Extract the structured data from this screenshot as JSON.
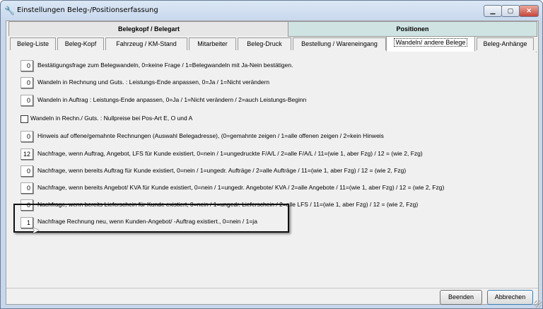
{
  "window": {
    "title": "Einstellungen Beleg-/Positionserfassung"
  },
  "top_tabs": [
    "Belegkopf / Belegart",
    "Positionen"
  ],
  "sub_tabs": [
    "Beleg-Liste",
    "Beleg-Kopf",
    "Fahrzeug / KM-Stand",
    "Mitarbeiter",
    "Beleg-Druck",
    "Bestellung / Wareneingang",
    "Wandeln/ andere Belege",
    "Beleg-Anhänge"
  ],
  "active_sub_tab": "Wandeln/ andere Belege",
  "settings": [
    {
      "value": "0",
      "label": "Bestätigungsfrage zum Belegwandeln, 0=keine Frage / 1=Belegwandeln mit Ja-Nein bestätigen."
    },
    {
      "value": "0",
      "label": "Wandeln in Rechnung und Guts. : Leistungs-Ende anpassen, 0=Ja / 1=Nicht verändern"
    },
    {
      "value": "0",
      "label": "Wandeln in Auftrag : Leistungs-Ende anpassen, 0=Ja / 1=Nicht verändern / 2=auch Leistungs-Beginn"
    },
    {
      "checkbox": true,
      "checked": false,
      "label": "Wandeln in Rechn./ Guts. : Nullpreise bei Pos-Art E, O und A"
    },
    {
      "value": "0",
      "label": "Hinweis auf offene/gemahnte Rechnungen (Auswahl Belegadresse), (0=gemahnte zeigen / 1=alle offenen zeigen / 2=kein Hinweis"
    },
    {
      "value": "12",
      "label": "Nachfrage, wenn Auftrag, Angebot, LFS für Kunde existiert, 0=nein / 1=ungedruckte F/A/L / 2=alle F/A/L / 11=(wie 1, aber Fzg) / 12 = (wie 2, Fzg)"
    },
    {
      "value": "0",
      "label": "Nachfrage, wenn bereits Auftrag für Kunde existiert, 0=nein / 1=ungedr. Aufträge / 2=alle Aufträge / 11=(wie 1, aber Fzg) / 12 = (wie 2, Fzg)"
    },
    {
      "value": "0",
      "label": "Nachfrage, wenn bereits Angebot/ KVA für Kunde existiert, 0=nein / 1=ungedr. Angebote/ KVA / 2=alle Angebote / 11=(wie 1, aber Fzg) / 12 = (wie 2, Fzg)"
    },
    {
      "value": "0",
      "label": "Nachfrage, wenn bereits Lieferschein für Kunde existiert, 0=nein / 1=ungedr. Lieferschein / 2=alle LFS / 11=(wie 1, aber Fzg) / 12 = (wie 2, Fzg)"
    },
    {
      "value": "1",
      "label": "Nachfrage Rechnung neu, wenn Kunden-Angebot/ -Auftrag existiert., 0=nein / 1=ja"
    }
  ],
  "buttons": {
    "beenden": "Beenden",
    "abbrechen": "Abbrechen"
  },
  "colors": {
    "positionen_tab": "#cfe3e3",
    "highlight_border": "#111111"
  }
}
